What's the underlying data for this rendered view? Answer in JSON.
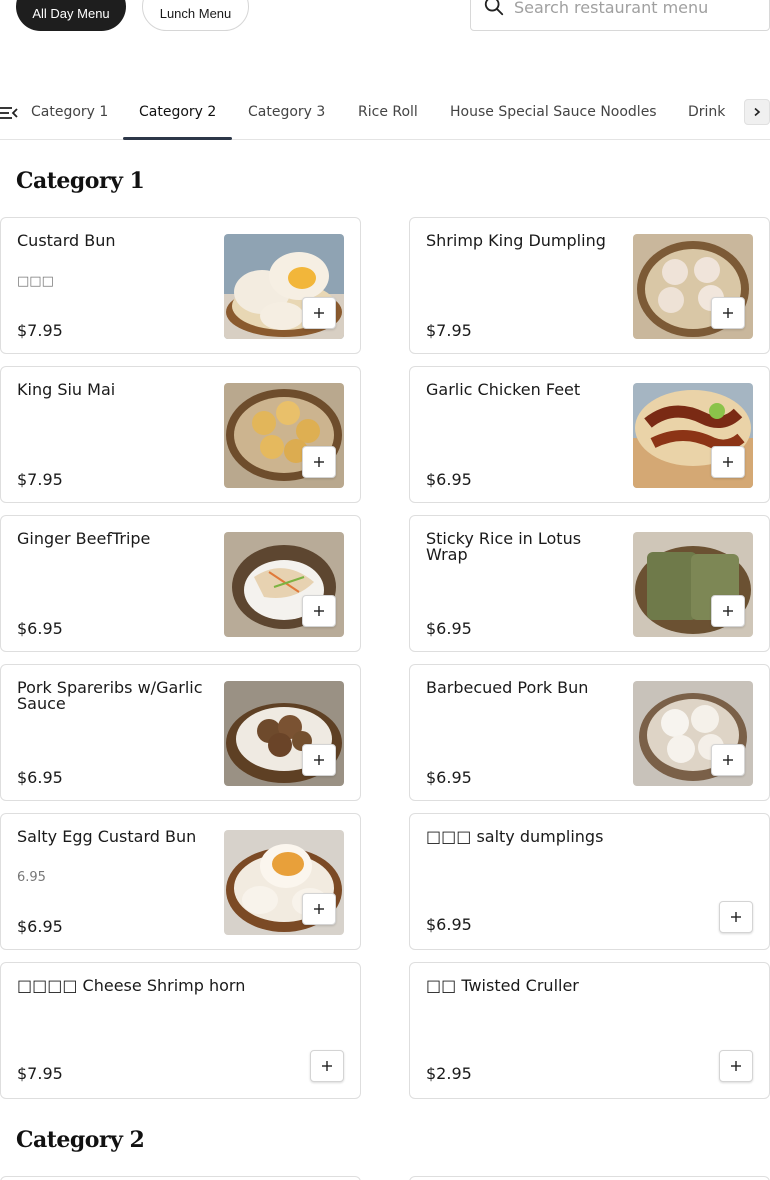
{
  "top_bar": {
    "menus": [
      "All Day Menu",
      "Lunch Menu"
    ],
    "search_placeholder": "Search restaurant menu"
  },
  "nav": {
    "tabs": [
      "Category 1",
      "Category 2",
      "Category 3",
      "Rice Roll",
      "House Special Sauce Noodles",
      "Drink"
    ],
    "active_tab": "Category 2"
  },
  "sections": [
    {
      "title": "Category 1",
      "items": [
        {
          "name": "Custard Bun",
          "description": "□□□",
          "price": "$7.95",
          "photo": "custard-bun-photo"
        },
        {
          "name": "Shrimp King Dumpling",
          "description": "",
          "price": "$7.95",
          "photo": "shrimp-dumpling-photo"
        },
        {
          "name": "King Siu Mai",
          "description": "",
          "price": "$7.95",
          "photo": "siu-mai-photo"
        },
        {
          "name": "Garlic Chicken Feet",
          "description": "",
          "price": "$6.95",
          "photo": "chicken-feet-photo"
        },
        {
          "name": "Ginger BeefTripe",
          "description": "",
          "price": "$6.95",
          "photo": "beef-tripe-photo"
        },
        {
          "name": "Sticky Rice in Lotus Wrap",
          "description": "",
          "price": "$6.95",
          "photo": "lotus-wrap-photo"
        },
        {
          "name": "Pork Spareribs w/Garlic Sauce",
          "description": "",
          "price": "$6.95",
          "photo": "spareribs-photo"
        },
        {
          "name": "Barbecued Pork Bun",
          "description": "",
          "price": "$6.95",
          "photo": "bbq-pork-bun-photo"
        },
        {
          "name": "Salty Egg Custard Bun",
          "description": "6.95",
          "price": "$6.95",
          "photo": "egg-custard-bun-photo"
        },
        {
          "name": "□□□ salty dumplings",
          "description": "",
          "price": "$6.95",
          "photo": ""
        },
        {
          "name": "□□□□ Cheese Shrimp horn",
          "description": "",
          "price": "$7.95",
          "photo": ""
        },
        {
          "name": "□□ Twisted Cruller",
          "description": "",
          "price": "$2.95",
          "photo": ""
        }
      ]
    },
    {
      "title": "Category 2",
      "items": []
    }
  ],
  "colors": {
    "active_pill_bg": "#1e1e1e",
    "tab_underline": "#2d3748",
    "border": "#dedede",
    "placeholder": "#a0a0a0"
  },
  "icons": [
    "search-icon",
    "menu-list-icon",
    "chevron-right-icon",
    "plus-icon"
  ]
}
